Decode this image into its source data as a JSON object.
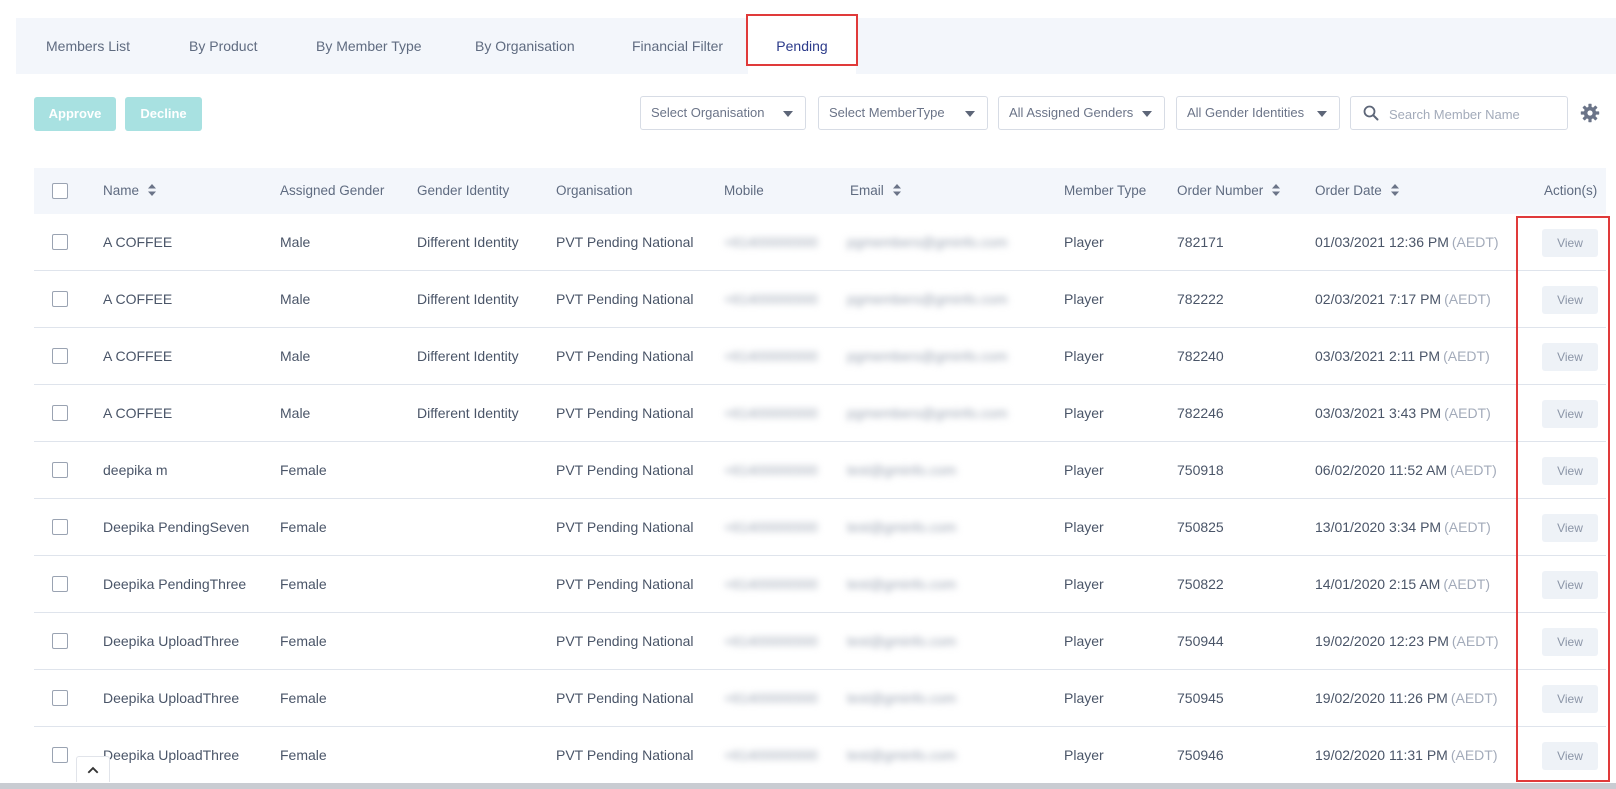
{
  "tabs": [
    {
      "label": "Members List"
    },
    {
      "label": "By Product"
    },
    {
      "label": "By Member Type"
    },
    {
      "label": "By Organisation"
    },
    {
      "label": "Financial Filter"
    },
    {
      "label": "Pending",
      "active": true
    }
  ],
  "toolbar": {
    "approve_label": "Approve",
    "decline_label": "Decline",
    "filters": [
      {
        "value": "Select Organisation"
      },
      {
        "value": "Select MemberType"
      },
      {
        "value": "All Assigned Genders"
      },
      {
        "value": "All Gender Identities"
      }
    ],
    "search_placeholder": "Search Member Name",
    "settings_icon": "gear-icon",
    "search_icon": "search-icon"
  },
  "table": {
    "headers": {
      "name": "Name",
      "assigned_gender": "Assigned Gender",
      "gender_identity": "Gender Identity",
      "organisation": "Organisation",
      "mobile": "Mobile",
      "email": "Email",
      "member_type": "Member Type",
      "order_number": "Order Number",
      "order_date": "Order Date",
      "actions": "Action(s)"
    },
    "rows": [
      {
        "name": "A COFFEE",
        "assigned_gender": "Male",
        "gender_identity": "Different Identity",
        "organisation": "PVT Pending National",
        "mobile": "+61400000000",
        "email": "pgmembers@gminfo.com",
        "member_type": "Player",
        "order_number": "782171",
        "order_date": "01/03/2021 12:36 PM",
        "tz": "(AEDT)",
        "action": "View"
      },
      {
        "name": "A COFFEE",
        "assigned_gender": "Male",
        "gender_identity": "Different Identity",
        "organisation": "PVT Pending National",
        "mobile": "+61400000000",
        "email": "pgmembers@gminfo.com",
        "member_type": "Player",
        "order_number": "782222",
        "order_date": "02/03/2021 7:17 PM",
        "tz": "(AEDT)",
        "action": "View"
      },
      {
        "name": "A COFFEE",
        "assigned_gender": "Male",
        "gender_identity": "Different Identity",
        "organisation": "PVT Pending National",
        "mobile": "+61400000000",
        "email": "pgmembers@gminfo.com",
        "member_type": "Player",
        "order_number": "782240",
        "order_date": "03/03/2021 2:11 PM",
        "tz": "(AEDT)",
        "action": "View"
      },
      {
        "name": "A COFFEE",
        "assigned_gender": "Male",
        "gender_identity": "Different Identity",
        "organisation": "PVT Pending National",
        "mobile": "+61400000000",
        "email": "pgmembers@gminfo.com",
        "member_type": "Player",
        "order_number": "782246",
        "order_date": "03/03/2021 3:43 PM",
        "tz": "(AEDT)",
        "action": "View"
      },
      {
        "name": "deepika m",
        "assigned_gender": "Female",
        "gender_identity": "",
        "organisation": "PVT Pending National",
        "mobile": "+61400000000",
        "email": "test@gminfo.com",
        "member_type": "Player",
        "order_number": "750918",
        "order_date": "06/02/2020 11:52 AM",
        "tz": "(AEDT)",
        "action": "View"
      },
      {
        "name": "Deepika PendingSeven",
        "assigned_gender": "Female",
        "gender_identity": "",
        "organisation": "PVT Pending National",
        "mobile": "+61400000000",
        "email": "test@gminfo.com",
        "member_type": "Player",
        "order_number": "750825",
        "order_date": "13/01/2020 3:34 PM",
        "tz": "(AEDT)",
        "action": "View"
      },
      {
        "name": "Deepika PendingThree",
        "assigned_gender": "Female",
        "gender_identity": "",
        "organisation": "PVT Pending National",
        "mobile": "+61400000000",
        "email": "test@gminfo.com",
        "member_type": "Player",
        "order_number": "750822",
        "order_date": "14/01/2020 2:15 AM",
        "tz": "(AEDT)",
        "action": "View"
      },
      {
        "name": "Deepika UploadThree",
        "assigned_gender": "Female",
        "gender_identity": "",
        "organisation": "PVT Pending National",
        "mobile": "+61400000000",
        "email": "test@gminfo.com",
        "member_type": "Player",
        "order_number": "750944",
        "order_date": "19/02/2020 12:23 PM",
        "tz": "(AEDT)",
        "action": "View"
      },
      {
        "name": "Deepika UploadThree",
        "assigned_gender": "Female",
        "gender_identity": "",
        "organisation": "PVT Pending National",
        "mobile": "+61400000000",
        "email": "test@gminfo.com",
        "member_type": "Player",
        "order_number": "750945",
        "order_date": "19/02/2020 11:26 PM",
        "tz": "(AEDT)",
        "action": "View"
      },
      {
        "name": "Deepika UploadThree",
        "assigned_gender": "Female",
        "gender_identity": "",
        "organisation": "PVT Pending National",
        "mobile": "+61400000000",
        "email": "test@gminfo.com",
        "member_type": "Player",
        "order_number": "750946",
        "order_date": "19/02/2020 11:31 PM",
        "tz": "(AEDT)",
        "action": "View"
      }
    ]
  },
  "colors": {
    "accent": "#a8e1e1",
    "highlight": "#e03a3a",
    "active_tab_text": "#2b3a8a"
  }
}
